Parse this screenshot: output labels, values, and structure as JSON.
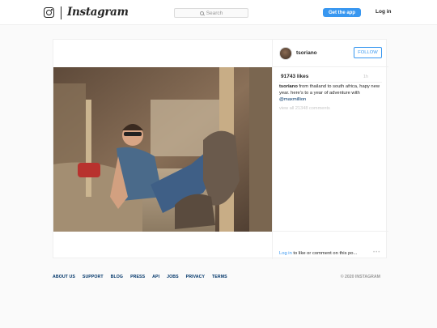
{
  "header": {
    "wordmark": "Instagram",
    "search_placeholder": "Search",
    "get_app_label": "Get the app",
    "login_label": "Log in"
  },
  "post": {
    "username": "tsoriano",
    "follow_label": "FOLLOW",
    "likes": "91743 likes",
    "time_ago": "1h",
    "caption": {
      "user": "tsoriano",
      "text": "from thailand to south africa, hapy new year. here's to a year of adventure with",
      "mention": "@maxmillion"
    },
    "view_all_comments": "view all 21348 comments",
    "comment_prompt": {
      "login": "Log in",
      "rest": "to like or comment on this po..."
    },
    "more_icon": "more-horizontal-icon"
  },
  "footer": {
    "links": [
      "ABOUT US",
      "SUPPORT",
      "BLOG",
      "PRESS",
      "API",
      "JOBS",
      "PRIVACY",
      "TERMS"
    ],
    "copyright": "© 2020 INSTAGRAM"
  },
  "colors": {
    "accent": "#3897f0",
    "link": "#003569",
    "muted": "#c7c7c7"
  }
}
